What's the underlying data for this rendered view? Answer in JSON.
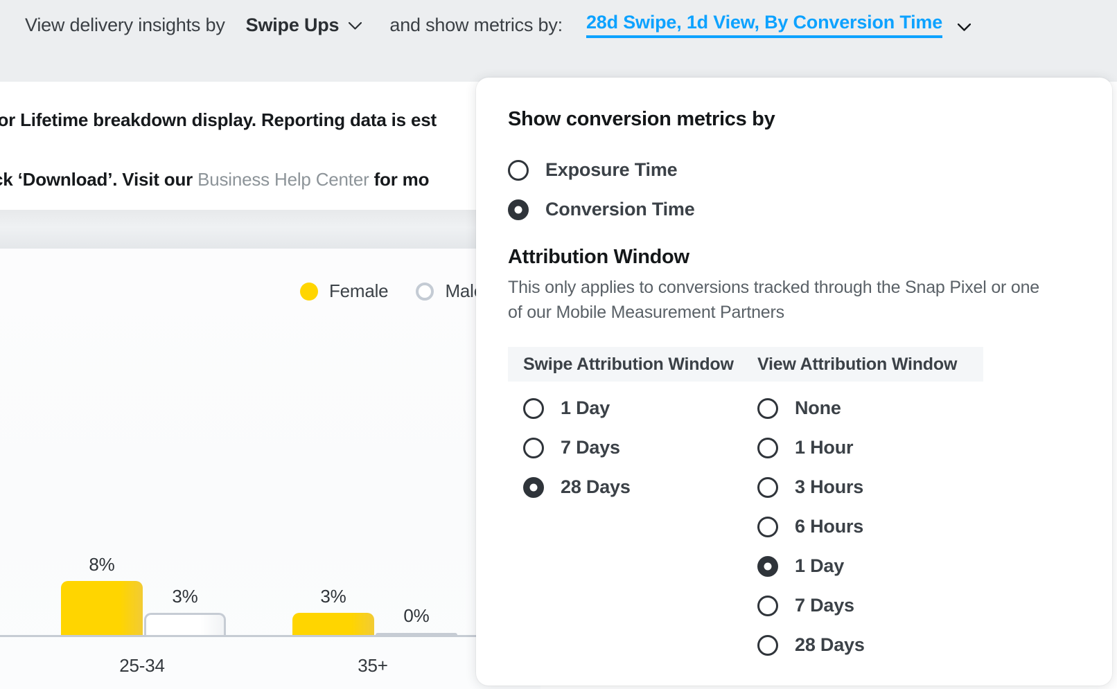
{
  "topbar": {
    "prefix_label": "View delivery insights by",
    "breakdown_value": "Swipe Ups",
    "middle_label": "and show metrics by:",
    "metrics_value": "28d Swipe, 1d View, By Conversion Time",
    "breakdown_caret_icon": "chevron-down-icon",
    "metrics_caret_icon": "chevron-down-icon",
    "link_color": "#0da2ff"
  },
  "background_page": {
    "notice_line_1": "for Lifetime breakdown display. Reporting data is est",
    "notice_line_2_a": "lick ‘Download’. Visit our ",
    "notice_line_2_link": "Business Help Center",
    "notice_line_2_b": " for mo"
  },
  "chart_data": {
    "type": "bar",
    "title": "",
    "categories": [
      "25-34",
      "35+"
    ],
    "series": [
      {
        "name": "Female",
        "values": [
          8,
          3
        ],
        "color": "#ffd500"
      },
      {
        "name": "Male",
        "values": [
          3,
          0
        ],
        "color": "#ffffff"
      }
    ],
    "value_labels": [
      [
        "8%",
        "3%"
      ],
      [
        "3%",
        "0%"
      ]
    ],
    "ylabel": "",
    "xlabel": "",
    "ylim": [
      0,
      10
    ],
    "grid": false,
    "legend_position": "top-right",
    "legend": [
      "Female",
      "Male"
    ]
  },
  "panel": {
    "heading": "Show conversion metrics by",
    "metric_options": [
      {
        "label": "Exposure Time",
        "selected": false
      },
      {
        "label": "Conversion Time",
        "selected": true
      }
    ],
    "attribution_heading": "Attribution Window",
    "attribution_desc": "This only applies to conversions tracked through the Snap Pixel or one of our Mobile Measurement Partners",
    "table": {
      "headers": [
        "Swipe Attribution Window",
        "View Attribution Window"
      ],
      "swipe_options": [
        {
          "label": "1 Day",
          "selected": false
        },
        {
          "label": "7 Days",
          "selected": false
        },
        {
          "label": "28 Days",
          "selected": true
        }
      ],
      "view_options": [
        {
          "label": "None",
          "selected": false
        },
        {
          "label": "1 Hour",
          "selected": false
        },
        {
          "label": "3 Hours",
          "selected": false
        },
        {
          "label": "6 Hours",
          "selected": false
        },
        {
          "label": "1 Day",
          "selected": true
        },
        {
          "label": "7 Days",
          "selected": false
        },
        {
          "label": "28 Days",
          "selected": false
        }
      ]
    }
  }
}
